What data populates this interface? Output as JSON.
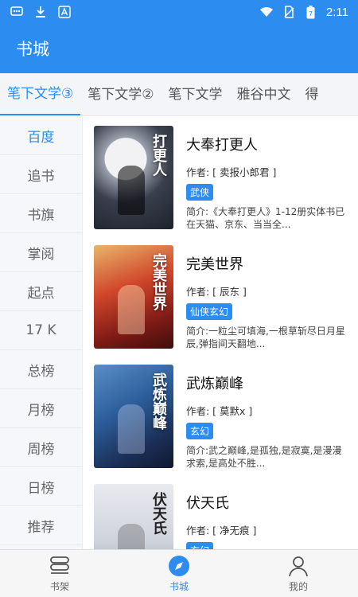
{
  "status_bar": {
    "time": "2:11",
    "left_icons": [
      "message-icon",
      "download-icon",
      "a-icon"
    ],
    "right_icons": [
      "wifi-icon",
      "no-sim-icon",
      "battery-icon"
    ]
  },
  "app_bar": {
    "title": "书城"
  },
  "source_tabs": [
    "笔下文学③",
    "笔下文学②",
    "笔下文学",
    "雅谷中文",
    "得"
  ],
  "active_source_index": 0,
  "categories": [
    "百度",
    "追书",
    "书旗",
    "掌阅",
    "起点",
    "17 K",
    "总榜",
    "月榜",
    "周榜",
    "日榜",
    "推荐"
  ],
  "active_category_index": 0,
  "books": [
    {
      "title": "大奉打更人",
      "author": "作者: [ 卖报小郎君 ]",
      "tag": "武侠",
      "desc": "简介:《大奉打更人》1-12册实体书已在天猫、京东、当当全...",
      "cover_text": "打更人"
    },
    {
      "title": "完美世界",
      "author": "作者: [ 辰东 ]",
      "tag": "仙侠玄幻",
      "desc": "简介:一粒尘可填海,一根草斩尽日月星辰,弹指间天翻地...",
      "cover_text": "完美世界"
    },
    {
      "title": "武炼巅峰",
      "author": "作者: [ 莫默x ]",
      "tag": "玄幻",
      "desc": "简介:武之巅峰,是孤独,是寂寞,是漫漫求索,是高处不胜...",
      "cover_text": "武炼巅峰"
    },
    {
      "title": "伏天氏",
      "author": "作者: [ 净无痕 ]",
      "tag": "玄幻",
      "desc": "",
      "cover_text": "伏天氏"
    }
  ],
  "bottom_nav": [
    {
      "label": "书架",
      "icon": "bookshelf-icon"
    },
    {
      "label": "书城",
      "icon": "compass-icon"
    },
    {
      "label": "我的",
      "icon": "user-icon"
    }
  ],
  "active_nav_index": 1,
  "colors": {
    "primary": "#2d8cf0",
    "sidebar_bg": "#f5f7fa",
    "nav_bg": "#f6f6f6"
  }
}
